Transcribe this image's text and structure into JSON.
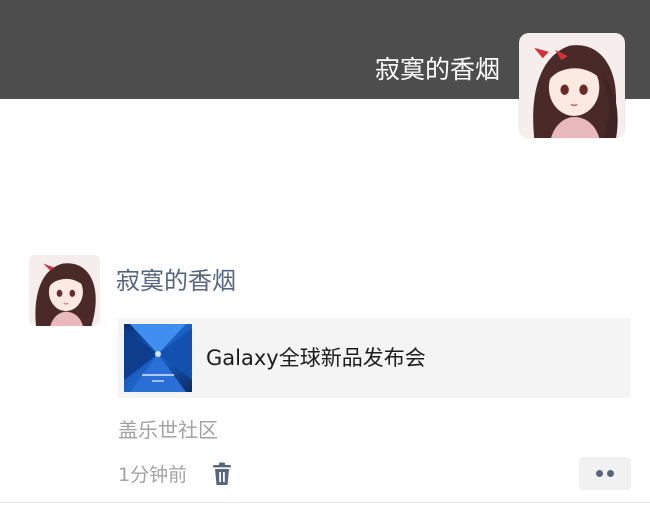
{
  "header": {
    "username": "寂寞的香烟",
    "avatar_icon": "anime-girl-avatar-icon",
    "background_color": "#4d4d4d"
  },
  "post": {
    "author": "寂寞的香烟",
    "avatar_icon": "anime-girl-avatar-icon",
    "link": {
      "title": "Galaxy全球新品发布会",
      "thumbnail_icon": "galaxy-launch-thumbnail-icon"
    },
    "source": "盖乐世社区",
    "time": "1分钟前",
    "delete_icon": "trash-icon",
    "more_icon": "more-dots-icon",
    "author_color": "#56657f"
  }
}
